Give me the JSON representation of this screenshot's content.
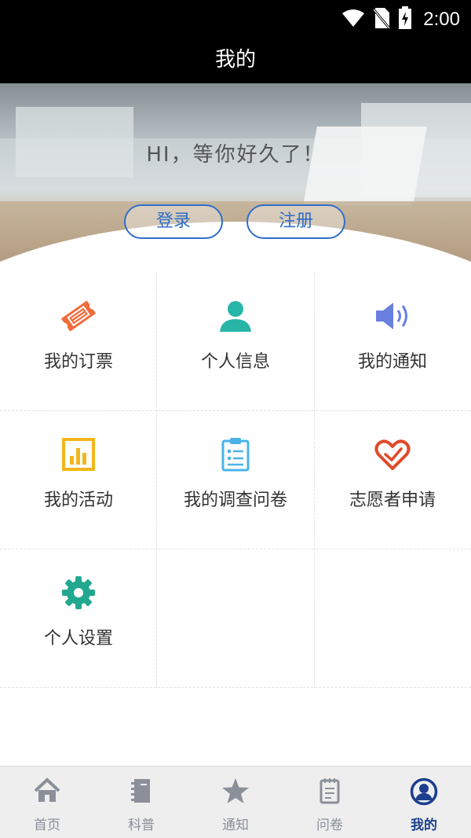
{
  "status_bar": {
    "time": "2:00",
    "icons": [
      "wifi-icon",
      "no-sim-icon",
      "battery-charging-icon"
    ]
  },
  "header": {
    "title": "我的"
  },
  "hero": {
    "greeting": "HI，等你好久了！",
    "login_label": "登录",
    "register_label": "注册"
  },
  "menu": {
    "items": [
      {
        "label": "我的订票",
        "icon": "ticket-icon",
        "color": "#f26b3a"
      },
      {
        "label": "个人信息",
        "icon": "person-icon",
        "color": "#26b5a6"
      },
      {
        "label": "我的通知",
        "icon": "speaker-icon",
        "color": "#6a7fe0"
      },
      {
        "label": "我的活动",
        "icon": "bar-chart-icon",
        "color": "#f3b61c"
      },
      {
        "label": "我的调查问卷",
        "icon": "clipboard-icon",
        "color": "#4ab3e8"
      },
      {
        "label": "志愿者申请",
        "icon": "heart-hand-icon",
        "color": "#e04a2b"
      },
      {
        "label": "个人设置",
        "icon": "gear-icon",
        "color": "#21a88f"
      }
    ]
  },
  "tabbar": {
    "tabs": [
      {
        "label": "首页",
        "icon": "home-icon"
      },
      {
        "label": "科普",
        "icon": "notebook-icon"
      },
      {
        "label": "通知",
        "icon": "star-icon"
      },
      {
        "label": "问卷",
        "icon": "document-icon"
      },
      {
        "label": "我的",
        "icon": "user-circle-icon",
        "active": true
      }
    ],
    "active_color": "#1c3f8f",
    "inactive_color": "#8a8f99"
  }
}
